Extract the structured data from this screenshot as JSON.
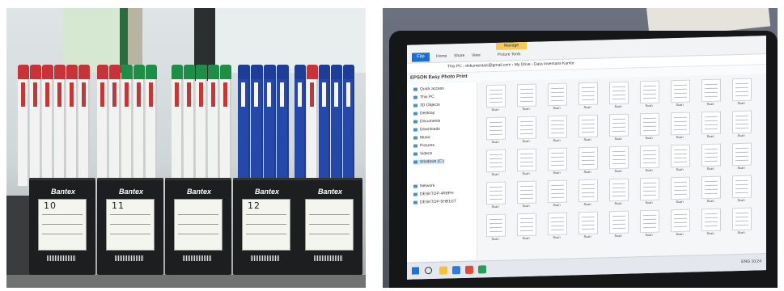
{
  "left_photo": {
    "box_brand": "Bantex",
    "box_numbers": [
      "10",
      "11",
      "",
      "12",
      ""
    ]
  },
  "right_photo": {
    "ribbon": {
      "file": "File",
      "manage": "Manage",
      "tabs": [
        "Home",
        "Share",
        "View",
        "Picture Tools"
      ]
    },
    "address_path": "This PC › dokumentasi@gmail.com › My Drive › Data Inventaris Kantor",
    "epson_bar": "EPSON Easy Photo Print",
    "nav_items": [
      "Quick access",
      "This PC",
      "3D Objects",
      "Desktop",
      "Documents",
      "Downloads",
      "Music",
      "Pictures",
      "Videos",
      "Windows (C:)",
      "Network",
      "DESKTOP-4R8PH",
      "DESKTOP-5HB1GT"
    ],
    "file_caption": "Scan",
    "taskbar_time": "ENG 10:24"
  }
}
